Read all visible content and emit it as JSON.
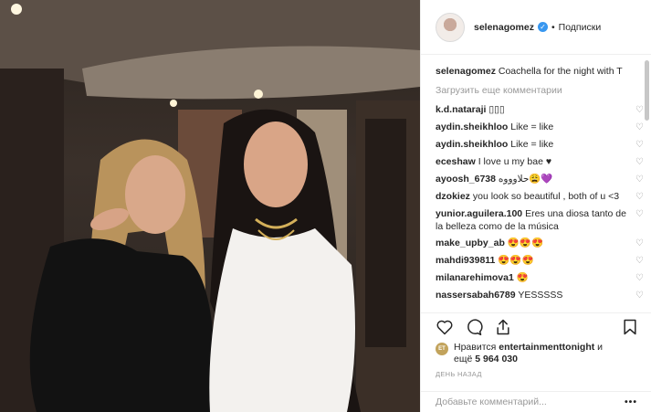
{
  "header": {
    "username": "selenagomez",
    "separator": "•",
    "follow_label": "Подписки"
  },
  "caption": {
    "username": "selenagomez",
    "text": "Coachella for the night with T"
  },
  "load_more": "Загрузить еще комментарии",
  "comments": [
    {
      "user": "k.d.nataraji",
      "text": "▯▯▯"
    },
    {
      "user": "aydin.sheikhloo",
      "text": "Like = like"
    },
    {
      "user": "aydin.sheikhloo",
      "text": "Like = like"
    },
    {
      "user": "eceshaw",
      "text": "I love u my bae ♥"
    },
    {
      "user": "ayoosh_6738",
      "text": "حلاوووه😩💜"
    },
    {
      "user": "dzokiez",
      "text": "you look so beautiful , both of u <3"
    },
    {
      "user": "yunior.aguilera.100",
      "text": "Eres una diosa tanto de la belleza como de la música"
    },
    {
      "user": "make_upby_ab",
      "text": "😍😍😍"
    },
    {
      "user": "mahdi939811",
      "text": "😍😍😍"
    },
    {
      "user": "milanarehimova1",
      "text": "😍"
    },
    {
      "user": "nassersabah6789",
      "text": "YESSSSS"
    }
  ],
  "likes": {
    "avatar_text": "ET",
    "prefix": "Нравится ",
    "user": "entertainmenttonight",
    "middle": " и",
    "line2_prefix": "ещё ",
    "count": "5 964 030"
  },
  "time_ago": "ДЕНЬ НАЗАД",
  "add_comment_placeholder": "Добавьте комментарий...",
  "more_label": "•••",
  "icons": {
    "heart": "heart-icon",
    "comment": "comment-icon",
    "share": "share-icon",
    "bookmark": "bookmark-icon",
    "verified": "verified-badge-icon"
  },
  "colors": {
    "verified_blue": "#3897f0",
    "muted_text": "#999999",
    "border": "#efefef"
  }
}
